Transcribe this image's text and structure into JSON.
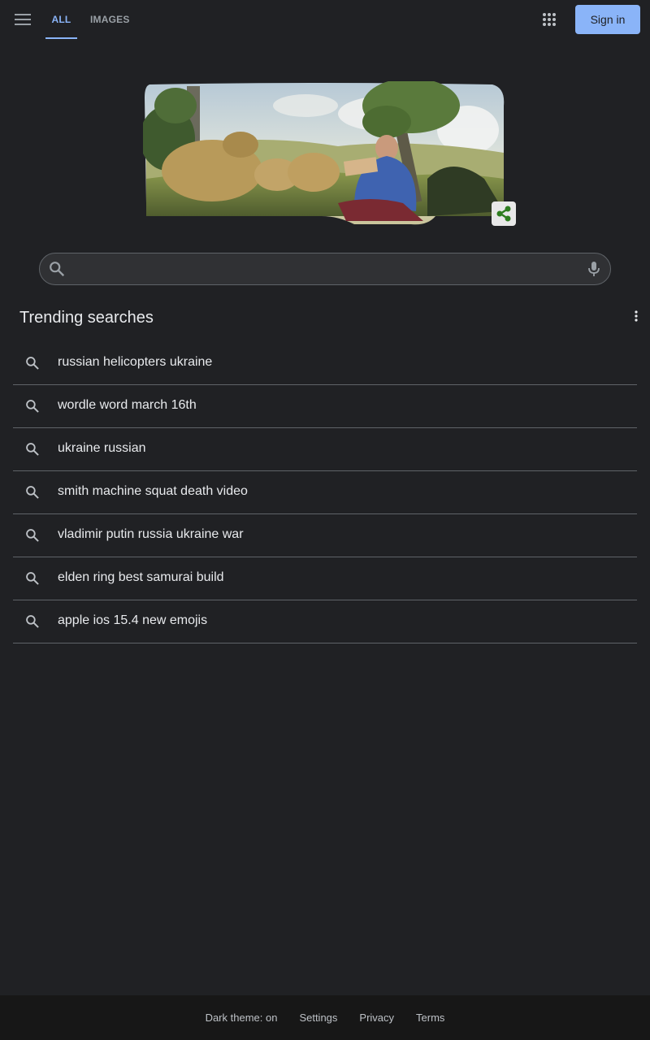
{
  "header": {
    "tabs": [
      {
        "label": "ALL",
        "active": true
      },
      {
        "label": "IMAGES",
        "active": false
      }
    ],
    "menu_icon": "hamburger-menu-icon",
    "apps_icon": "apps-grid-icon",
    "sign_in_label": "Sign in"
  },
  "doodle": {
    "description_icon": "doodle-illustration",
    "share_icon": "share-icon"
  },
  "search": {
    "value": "",
    "placeholder": "",
    "search_icon": "search-icon",
    "mic_icon": "microphone-icon"
  },
  "trending": {
    "title": "Trending searches",
    "more_icon": "more-vertical-icon",
    "items": [
      {
        "label": "russian helicopters ukraine"
      },
      {
        "label": "wordle word march 16th"
      },
      {
        "label": "ukraine russian"
      },
      {
        "label": "smith machine squat death video"
      },
      {
        "label": "vladimir putin russia ukraine war"
      },
      {
        "label": "elden ring best samurai build"
      },
      {
        "label": "apple ios 15.4 new emojis"
      }
    ]
  },
  "footer": {
    "dark_theme": "Dark theme: on",
    "settings": "Settings",
    "privacy": "Privacy",
    "terms": "Terms"
  },
  "colors": {
    "background": "#202124",
    "accent": "#8ab4f8",
    "text": "#e8eaed",
    "divider": "#5f6368",
    "footer_bg": "#171717"
  }
}
